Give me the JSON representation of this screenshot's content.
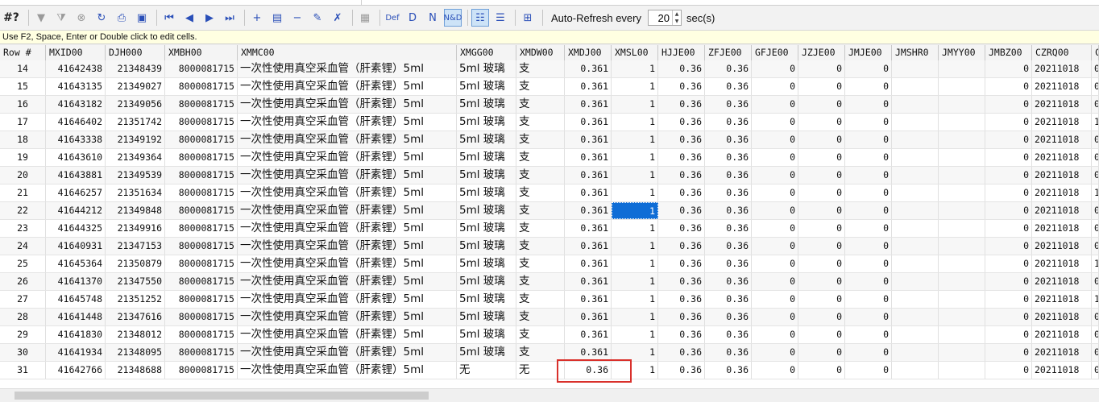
{
  "toolbar": {
    "help_label": "#?",
    "auto_refresh_label": "Auto-Refresh every",
    "interval_value": "20",
    "interval_unit": "sec(s)",
    "buttons": [
      {
        "name": "filter-icon",
        "glyph": "▼",
        "grey": true
      },
      {
        "name": "filter-clear-icon",
        "glyph": "⧩",
        "grey": true
      },
      {
        "name": "cancel-icon",
        "glyph": "⊗",
        "grey": true
      },
      {
        "name": "refresh-icon",
        "glyph": "↻",
        "grey": false
      },
      {
        "name": "print-icon",
        "glyph": "⎙",
        "grey": false
      },
      {
        "name": "save-icon",
        "glyph": "▣",
        "grey": false
      },
      {
        "name": "first-record-icon",
        "glyph": "⏮",
        "grey": false
      },
      {
        "name": "prev-record-icon",
        "glyph": "◀",
        "grey": false
      },
      {
        "name": "next-record-icon",
        "glyph": "▶",
        "grey": false
      },
      {
        "name": "last-record-icon",
        "glyph": "⏭",
        "grey": false
      },
      {
        "name": "add-record-icon",
        "glyph": "+",
        "grey": false
      },
      {
        "name": "insert-record-icon",
        "glyph": "▤",
        "grey": false
      },
      {
        "name": "delete-record-icon",
        "glyph": "−",
        "grey": false
      },
      {
        "name": "post-edit-icon",
        "glyph": "✎",
        "grey": false
      },
      {
        "name": "cancel-edit-icon",
        "glyph": "✗",
        "grey": false
      },
      {
        "name": "sql-icon",
        "glyph": "▦",
        "grey": true
      },
      {
        "name": "def-icon",
        "glyph": "Def",
        "grey": false
      },
      {
        "name": "d-icon",
        "glyph": "D",
        "grey": false
      },
      {
        "name": "n-icon",
        "glyph": "N",
        "grey": false
      },
      {
        "name": "nd-icon",
        "glyph": "N&D",
        "grey": false,
        "pressed": true
      },
      {
        "name": "grid-view-icon",
        "glyph": "☷",
        "grey": false,
        "pressed": true
      },
      {
        "name": "form-view-icon",
        "glyph": "☰",
        "grey": false
      },
      {
        "name": "auto-refresh-icon",
        "glyph": "⊞",
        "grey": false
      }
    ]
  },
  "hint": "Use F2, Space, Enter or Double click to edit cells.",
  "columns": [
    "Row #",
    "MXID00",
    "DJH000",
    "XMBH00",
    "XMMC00",
    "XMGG00",
    "XMDW00",
    "XMDJ00",
    "XMSL00",
    "HJJE00",
    "ZFJE00",
    "GFJE00",
    "JZJE00",
    "JMJE00",
    "JMSHR0",
    "JMYY00",
    "JMBZ00",
    "CZRQ00",
    "C"
  ],
  "rows": [
    [
      "14",
      "41642438",
      "21348439",
      "8000081715",
      "一次性使用真空采血管（肝素锂）5ml",
      "5ml 玻璃",
      "支",
      "0.361",
      "1",
      "0.36",
      "0.36",
      "0",
      "0",
      "0",
      "",
      "",
      "0",
      "20211018",
      "0"
    ],
    [
      "15",
      "41643135",
      "21349027",
      "8000081715",
      "一次性使用真空采血管（肝素锂）5ml",
      "5ml 玻璃",
      "支",
      "0.361",
      "1",
      "0.36",
      "0.36",
      "0",
      "0",
      "0",
      "",
      "",
      "0",
      "20211018",
      "0"
    ],
    [
      "16",
      "41643182",
      "21349056",
      "8000081715",
      "一次性使用真空采血管（肝素锂）5ml",
      "5ml 玻璃",
      "支",
      "0.361",
      "1",
      "0.36",
      "0.36",
      "0",
      "0",
      "0",
      "",
      "",
      "0",
      "20211018",
      "0"
    ],
    [
      "17",
      "41646402",
      "21351742",
      "8000081715",
      "一次性使用真空采血管（肝素锂）5ml",
      "5ml 玻璃",
      "支",
      "0.361",
      "1",
      "0.36",
      "0.36",
      "0",
      "0",
      "0",
      "",
      "",
      "0",
      "20211018",
      "1"
    ],
    [
      "18",
      "41643338",
      "21349192",
      "8000081715",
      "一次性使用真空采血管（肝素锂）5ml",
      "5ml 玻璃",
      "支",
      "0.361",
      "1",
      "0.36",
      "0.36",
      "0",
      "0",
      "0",
      "",
      "",
      "0",
      "20211018",
      "0"
    ],
    [
      "19",
      "41643610",
      "21349364",
      "8000081715",
      "一次性使用真空采血管（肝素锂）5ml",
      "5ml 玻璃",
      "支",
      "0.361",
      "1",
      "0.36",
      "0.36",
      "0",
      "0",
      "0",
      "",
      "",
      "0",
      "20211018",
      "0"
    ],
    [
      "20",
      "41643881",
      "21349539",
      "8000081715",
      "一次性使用真空采血管（肝素锂）5ml",
      "5ml 玻璃",
      "支",
      "0.361",
      "1",
      "0.36",
      "0.36",
      "0",
      "0",
      "0",
      "",
      "",
      "0",
      "20211018",
      "0"
    ],
    [
      "21",
      "41646257",
      "21351634",
      "8000081715",
      "一次性使用真空采血管（肝素锂）5ml",
      "5ml 玻璃",
      "支",
      "0.361",
      "1",
      "0.36",
      "0.36",
      "0",
      "0",
      "0",
      "",
      "",
      "0",
      "20211018",
      "1"
    ],
    [
      "22",
      "41644212",
      "21349848",
      "8000081715",
      "一次性使用真空采血管（肝素锂）5ml",
      "5ml 玻璃",
      "支",
      "0.361",
      "1",
      "0.36",
      "0.36",
      "0",
      "0",
      "0",
      "",
      "",
      "0",
      "20211018",
      "0"
    ],
    [
      "23",
      "41644325",
      "21349916",
      "8000081715",
      "一次性使用真空采血管（肝素锂）5ml",
      "5ml 玻璃",
      "支",
      "0.361",
      "1",
      "0.36",
      "0.36",
      "0",
      "0",
      "0",
      "",
      "",
      "0",
      "20211018",
      "0"
    ],
    [
      "24",
      "41640931",
      "21347153",
      "8000081715",
      "一次性使用真空采血管（肝素锂）5ml",
      "5ml 玻璃",
      "支",
      "0.361",
      "1",
      "0.36",
      "0.36",
      "0",
      "0",
      "0",
      "",
      "",
      "0",
      "20211018",
      "0"
    ],
    [
      "25",
      "41645364",
      "21350879",
      "8000081715",
      "一次性使用真空采血管（肝素锂）5ml",
      "5ml 玻璃",
      "支",
      "0.361",
      "1",
      "0.36",
      "0.36",
      "0",
      "0",
      "0",
      "",
      "",
      "0",
      "20211018",
      "1"
    ],
    [
      "26",
      "41641370",
      "21347550",
      "8000081715",
      "一次性使用真空采血管（肝素锂）5ml",
      "5ml 玻璃",
      "支",
      "0.361",
      "1",
      "0.36",
      "0.36",
      "0",
      "0",
      "0",
      "",
      "",
      "0",
      "20211018",
      "0"
    ],
    [
      "27",
      "41645748",
      "21351252",
      "8000081715",
      "一次性使用真空采血管（肝素锂）5ml",
      "5ml 玻璃",
      "支",
      "0.361",
      "1",
      "0.36",
      "0.36",
      "0",
      "0",
      "0",
      "",
      "",
      "0",
      "20211018",
      "1"
    ],
    [
      "28",
      "41641448",
      "21347616",
      "8000081715",
      "一次性使用真空采血管（肝素锂）5ml",
      "5ml 玻璃",
      "支",
      "0.361",
      "1",
      "0.36",
      "0.36",
      "0",
      "0",
      "0",
      "",
      "",
      "0",
      "20211018",
      "0"
    ],
    [
      "29",
      "41641830",
      "21348012",
      "8000081715",
      "一次性使用真空采血管（肝素锂）5ml",
      "5ml 玻璃",
      "支",
      "0.361",
      "1",
      "0.36",
      "0.36",
      "0",
      "0",
      "0",
      "",
      "",
      "0",
      "20211018",
      "0"
    ],
    [
      "30",
      "41641934",
      "21348095",
      "8000081715",
      "一次性使用真空采血管（肝素锂）5ml",
      "5ml 玻璃",
      "支",
      "0.361",
      "1",
      "0.36",
      "0.36",
      "0",
      "0",
      "0",
      "",
      "",
      "0",
      "20211018",
      "0"
    ],
    [
      "31",
      "41642766",
      "21348688",
      "8000081715",
      "一次性使用真空采血管（肝素锂）5ml",
      "无",
      "无",
      "0.36",
      "1",
      "0.36",
      "0.36",
      "0",
      "0",
      "0",
      "",
      "",
      "0",
      "20211018",
      "0"
    ]
  ],
  "selected_cell": {
    "row": 8,
    "col": 8
  },
  "highlight_color": "#d9302b",
  "selection_color": "#0f6dd6"
}
